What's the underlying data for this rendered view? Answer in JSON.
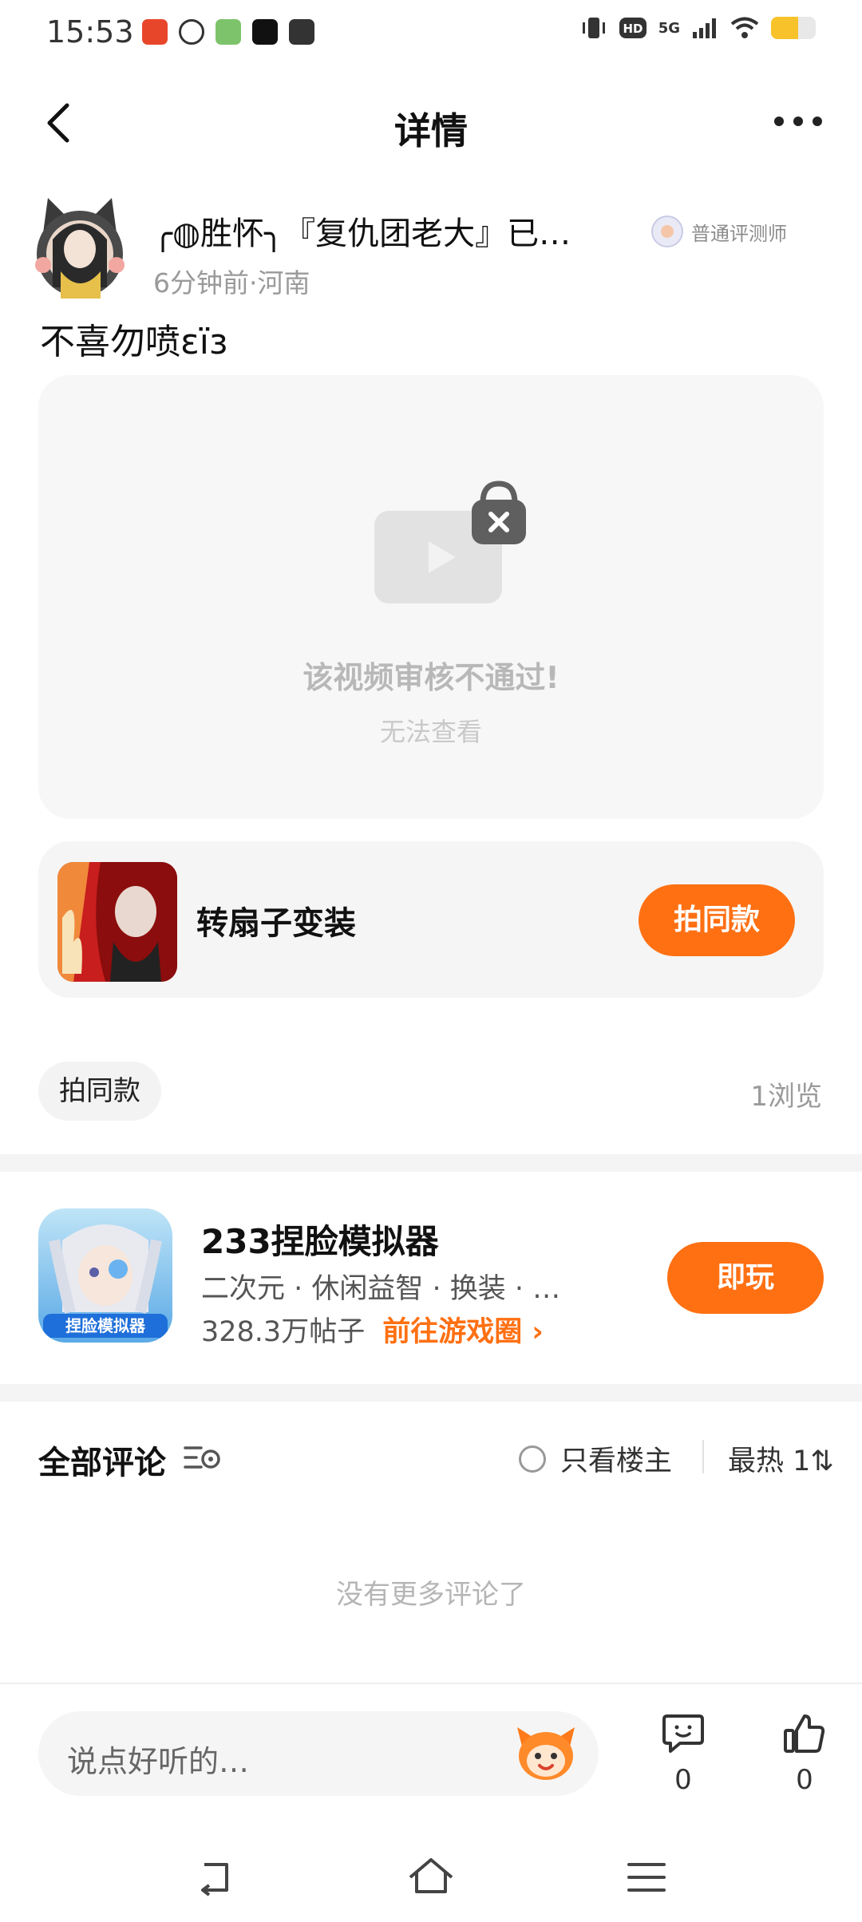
{
  "status_bar": {
    "time": "15:53",
    "network": "5G"
  },
  "header": {
    "title": "详情"
  },
  "author": {
    "name": "╭◍胜怀╮『复仇团老大』已…",
    "meta": "6分钟前·河南",
    "badge": "普通评测师"
  },
  "post": {
    "text": "不喜勿喷ɛïɜ"
  },
  "video": {
    "message": "该视频审核不通过!",
    "sub": "无法查看"
  },
  "template": {
    "title": "转扇子变装",
    "button": "拍同款"
  },
  "tag": {
    "label": "拍同款"
  },
  "views": "1浏览",
  "game": {
    "name": "233捏脸模拟器",
    "tags": "二次元 · 休闲益智 · 换装 · …",
    "posts": "328.3万帖子",
    "link": "前往游戏圈 ›",
    "button": "即玩",
    "icon_text": "捏脸模拟器"
  },
  "comments": {
    "title": "全部评论",
    "owner_only": "只看楼主",
    "sort": "最热 1⇅",
    "empty": "没有更多评论了"
  },
  "bottom": {
    "placeholder": "说点好听的…",
    "comment_count": "0",
    "like_count": "0"
  },
  "colors": {
    "accent": "#ff7013",
    "muted": "#9a9a9a",
    "card_bg": "#f5f5f5"
  }
}
